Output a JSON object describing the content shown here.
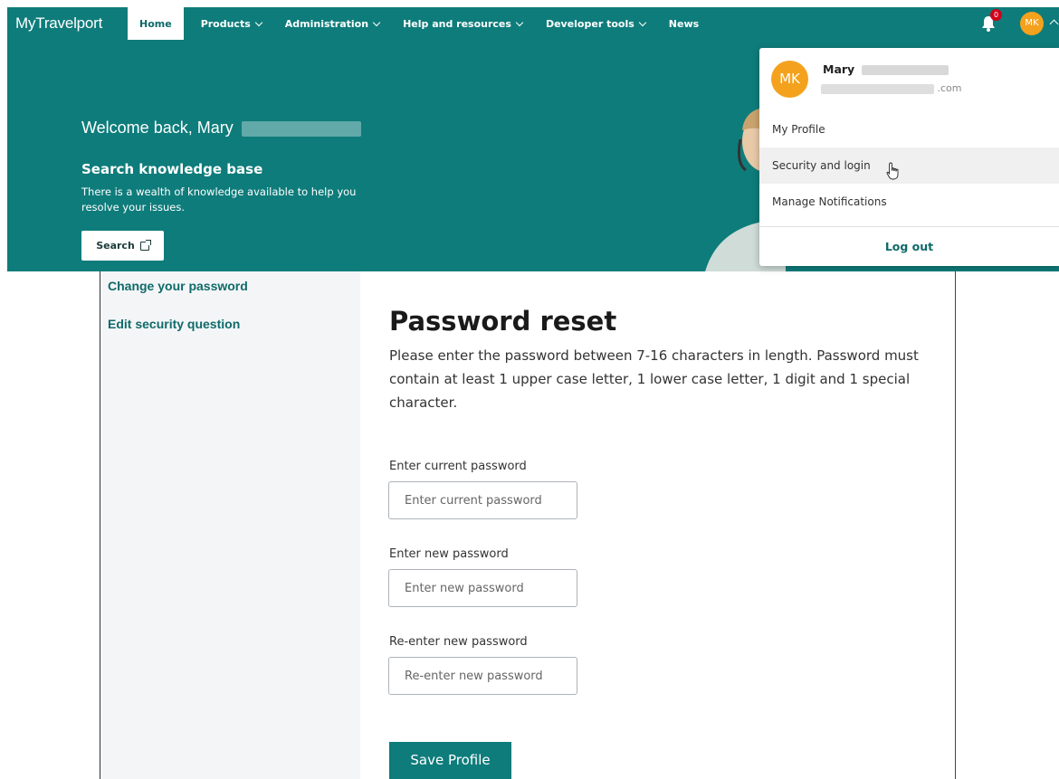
{
  "app": {
    "logo": "MyTravelport"
  },
  "nav": {
    "items": [
      {
        "label": "Home",
        "active": true,
        "has_dropdown": false
      },
      {
        "label": "Products",
        "active": false,
        "has_dropdown": true
      },
      {
        "label": "Administration",
        "active": false,
        "has_dropdown": true
      },
      {
        "label": "Help and resources",
        "active": false,
        "has_dropdown": true
      },
      {
        "label": "Developer tools",
        "active": false,
        "has_dropdown": true
      },
      {
        "label": "News",
        "active": false,
        "has_dropdown": false
      }
    ],
    "notifications": {
      "count": "0",
      "icon": "bell-icon"
    },
    "user": {
      "initials": "MK"
    }
  },
  "hero": {
    "welcome": "Welcome back, Mary",
    "kb_title": "Search knowledge base",
    "kb_desc": "There is a wealth of knowledge available to help you resolve your issues.",
    "search_label": "Search"
  },
  "sidebar": {
    "links": [
      {
        "label": "Change your password"
      },
      {
        "label": "Edit security question"
      }
    ]
  },
  "main": {
    "title": "Password reset",
    "description": "Please enter the password between 7-16 characters in length. Password must contain at least 1 upper case letter, 1 lower case letter, 1 digit and 1 special character.",
    "fields": [
      {
        "label": "Enter current password",
        "placeholder": "Enter current password",
        "value": ""
      },
      {
        "label": "Enter new password",
        "placeholder": "Enter new password",
        "value": ""
      },
      {
        "label": "Re-enter new password",
        "placeholder": "Re-enter new password",
        "value": ""
      }
    ],
    "save_label": "Save Profile"
  },
  "dropdown": {
    "initials": "MK",
    "name": "Mary",
    "email_suffix": ".com",
    "items": [
      {
        "label": "My Profile"
      },
      {
        "label": "Security and login"
      },
      {
        "label": "Manage Notifications"
      }
    ],
    "logout_label": "Log out"
  },
  "colors": {
    "brand": "#0e7c7b",
    "avatar": "#f4a21d",
    "badge": "#d0021b"
  }
}
